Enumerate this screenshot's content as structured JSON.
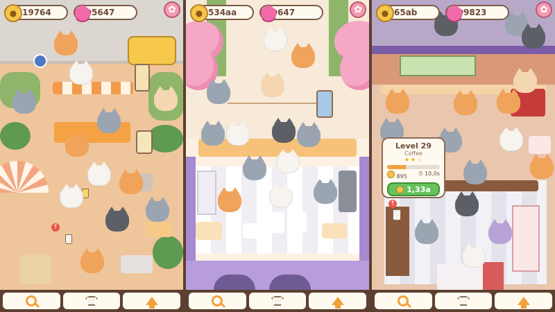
{
  "panels": [
    {
      "coins": "19764",
      "gems": "5647"
    },
    {
      "coins": "534aa",
      "gems": "647"
    },
    {
      "coins": "65ab",
      "gems": "9823"
    }
  ],
  "upgrade_popup": {
    "level": "Level 29",
    "item": "Coffee",
    "stars": "★★☆",
    "progress": 0.35,
    "stat_left": "895",
    "stat_right": "10,0s",
    "cost": "1,33a"
  },
  "icons": {
    "coin": "coin-icon",
    "gem": "gem-icon",
    "settings": "gear-icon",
    "nav": [
      "search-icon",
      "shirt-icon",
      "upgrade-arrow-icon"
    ]
  },
  "colors": {
    "hud_border": "#7a5a48",
    "coin": "#f7c548",
    "gem": "#f06aa7",
    "buy_button": "#66c25a",
    "nav_bar": "#5c3f30"
  }
}
